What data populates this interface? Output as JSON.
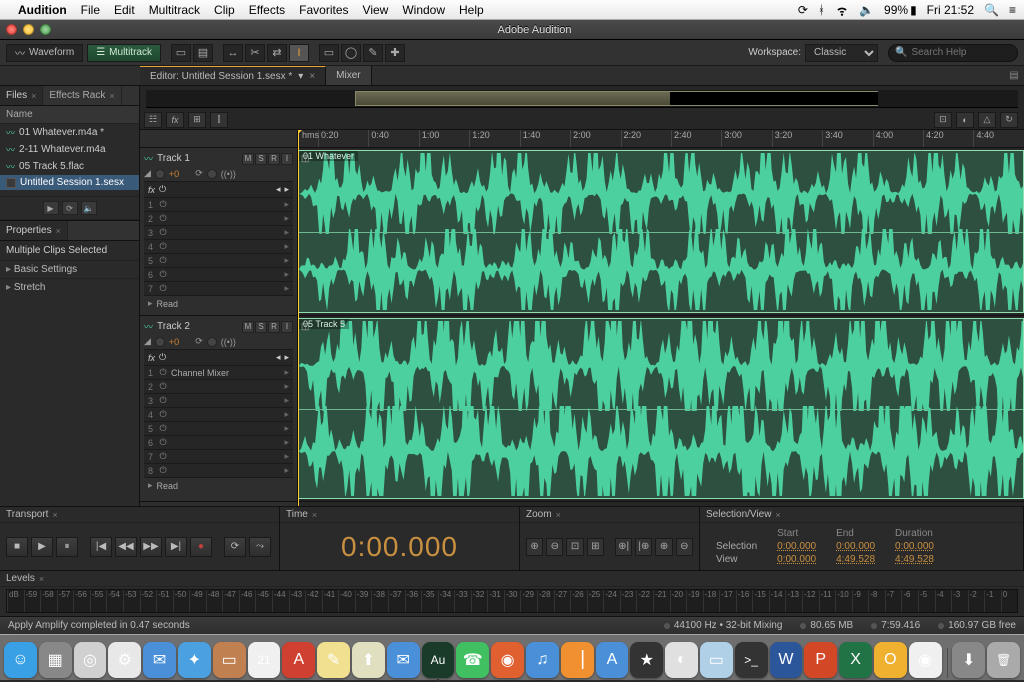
{
  "mac_menu": {
    "app": "Audition",
    "items": [
      "File",
      "Edit",
      "Multitrack",
      "Clip",
      "Effects",
      "Favorites",
      "View",
      "Window",
      "Help"
    ]
  },
  "mac_status": {
    "battery": "99%",
    "clock": "Fri 21:52"
  },
  "window": {
    "title": "Adobe Audition"
  },
  "toolbar": {
    "modes": {
      "waveform": "Waveform",
      "multitrack": "Multitrack"
    },
    "workspace_label": "Workspace:",
    "workspace_value": "Classic",
    "search_placeholder": "Search Help"
  },
  "editor_tabs": {
    "active": "Editor: Untitled Session 1.sesx *",
    "mixer": "Mixer"
  },
  "files_panel": {
    "tab_files": "Files",
    "tab_effects": "Effects Rack",
    "column": "Name",
    "items": [
      {
        "label": "01 Whatever.m4a *"
      },
      {
        "label": "2-11 Whatever.m4a"
      },
      {
        "label": "05 Track 5.flac"
      },
      {
        "label": "Untitled Session 1.sesx",
        "session": true,
        "selected": true
      }
    ]
  },
  "properties": {
    "title": "Properties",
    "header": "Multiple Clips Selected",
    "rows": [
      "Basic Settings",
      "Stretch"
    ]
  },
  "timeline": {
    "unit": "hms",
    "ticks": [
      "0:20",
      "0:40",
      "1:00",
      "1:20",
      "1:40",
      "2:00",
      "2:20",
      "2:40",
      "3:00",
      "3:20",
      "3:40",
      "4:00",
      "4:20",
      "4:40"
    ]
  },
  "tracks": [
    {
      "name": "Track 1",
      "vol": "+0",
      "clip_name": "01 Whatever",
      "fx": [
        "",
        "",
        "",
        "",
        "",
        "",
        ""
      ],
      "read": "Read",
      "height": 168
    },
    {
      "name": "Track 2",
      "vol": "+0",
      "clip_name": "05 Track 5",
      "fx": [
        "Channel Mixer",
        "",
        "",
        "",
        "",
        "",
        "",
        ""
      ],
      "read": "Read",
      "height": 186
    }
  ],
  "transport": {
    "title": "Transport"
  },
  "time_panel": {
    "title": "Time",
    "display": "0:00.000"
  },
  "zoom": {
    "title": "Zoom"
  },
  "selview": {
    "title": "Selection/View",
    "cols": [
      "Start",
      "End",
      "Duration"
    ],
    "rows": [
      {
        "label": "Selection",
        "start": "0:00.000",
        "end": "0:00.000",
        "dur": "0:00.000"
      },
      {
        "label": "View",
        "start": "0:00.000",
        "end": "4:49.528",
        "dur": "4:49.528"
      }
    ]
  },
  "levels": {
    "title": "Levels",
    "marks": [
      "dB",
      "-59",
      "-58",
      "-57",
      "-56",
      "-55",
      "-54",
      "-53",
      "-52",
      "-51",
      "-50",
      "-49",
      "-48",
      "-47",
      "-46",
      "-45",
      "-44",
      "-43",
      "-42",
      "-41",
      "-40",
      "-39",
      "-38",
      "-37",
      "-36",
      "-35",
      "-34",
      "-33",
      "-32",
      "-31",
      "-30",
      "-29",
      "-28",
      "-27",
      "-26",
      "-25",
      "-24",
      "-23",
      "-22",
      "-21",
      "-20",
      "-19",
      "-18",
      "-17",
      "-16",
      "-15",
      "-14",
      "-13",
      "-12",
      "-11",
      "-10",
      "-9",
      "-8",
      "-7",
      "-6",
      "-5",
      "-4",
      "-3",
      "-2",
      "-1",
      "0"
    ]
  },
  "status": {
    "message": "Apply Amplify completed in 0.47 seconds",
    "format": "44100 Hz • 32-bit Mixing",
    "mem": "80.65 MB",
    "time": "7:59.416",
    "disk": "160.97 GB free"
  },
  "dock": [
    {
      "n": "finder",
      "c": "#3aa0e6",
      "g": "☺"
    },
    {
      "n": "launchpad",
      "c": "#888",
      "g": "▦"
    },
    {
      "n": "app1",
      "c": "#d0d0d0",
      "g": "◎"
    },
    {
      "n": "app2",
      "c": "#e8e8e8",
      "g": "⚙"
    },
    {
      "n": "mail",
      "c": "#4a90d9",
      "g": "✉"
    },
    {
      "n": "safari",
      "c": "#4aa0e0",
      "g": "✦"
    },
    {
      "n": "contacts",
      "c": "#c08050",
      "g": "▭"
    },
    {
      "n": "calendar",
      "c": "#f0f0f0",
      "g": "21"
    },
    {
      "n": "reader",
      "c": "#d04030",
      "g": "A"
    },
    {
      "n": "notes",
      "c": "#f0e090",
      "g": "✎"
    },
    {
      "n": "maps",
      "c": "#e0e0c0",
      "g": "⬆"
    },
    {
      "n": "messages",
      "c": "#4a90d9",
      "g": "✉"
    },
    {
      "n": "audition",
      "c": "#1a3a2a",
      "g": "Au",
      "running": true
    },
    {
      "n": "facetime",
      "c": "#40c060",
      "g": "☎"
    },
    {
      "n": "photobooth",
      "c": "#e06030",
      "g": "◉"
    },
    {
      "n": "itunes",
      "c": "#4a90d9",
      "g": "♫"
    },
    {
      "n": "ibooks",
      "c": "#f09030",
      "g": "▕"
    },
    {
      "n": "appstore",
      "c": "#4a90d9",
      "g": "A"
    },
    {
      "n": "imovie",
      "c": "#333",
      "g": "★"
    },
    {
      "n": "game",
      "c": "#e0e0e0",
      "g": "◐"
    },
    {
      "n": "preview",
      "c": "#b0d0e8",
      "g": "▭"
    },
    {
      "n": "terminal",
      "c": "#333",
      "g": ">_"
    },
    {
      "n": "word",
      "c": "#2b579a",
      "g": "W"
    },
    {
      "n": "powerpoint",
      "c": "#d24726",
      "g": "P"
    },
    {
      "n": "excel",
      "c": "#217346",
      "g": "X"
    },
    {
      "n": "outlook",
      "c": "#f0b030",
      "g": "O"
    },
    {
      "n": "chrome",
      "c": "#f0f0f0",
      "g": "◉"
    },
    {
      "n": "downloads",
      "c": "#888",
      "g": "⬇"
    },
    {
      "n": "trash",
      "c": "#aaa",
      "g": "🗑"
    }
  ]
}
